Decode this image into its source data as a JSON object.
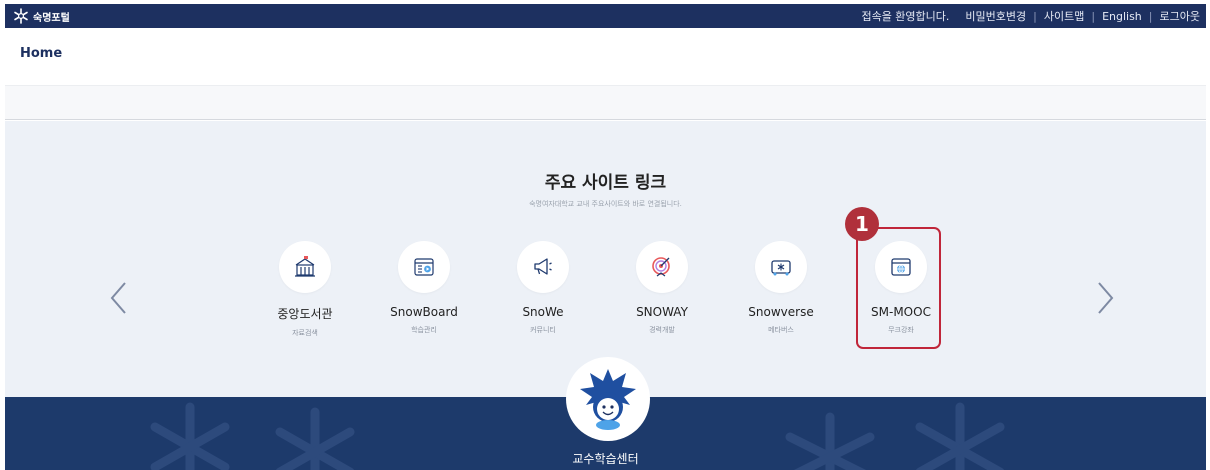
{
  "topbar": {
    "logo_text": "숙명포털",
    "welcome": "접속을 환영합니다.",
    "links": [
      "비밀번호변경",
      "사이트맵",
      "English",
      "로그아웃"
    ]
  },
  "breadcrumb": {
    "home": "Home"
  },
  "section": {
    "title": "주요 사이트 링크",
    "subtitle": "숙명여자대학교 교내 주요사이트와 바로 연결됩니다."
  },
  "items": [
    {
      "label": "중앙도서관",
      "sub": "자료검색",
      "icon": "library-icon"
    },
    {
      "label": "SnowBoard",
      "sub": "학습관리",
      "icon": "board-icon"
    },
    {
      "label": "SnoWe",
      "sub": "커뮤니티",
      "icon": "megaphone-icon"
    },
    {
      "label": "SNOWAY",
      "sub": "경력개발",
      "icon": "target-icon"
    },
    {
      "label": "Snowverse",
      "sub": "메타버스",
      "icon": "metaverse-icon"
    },
    {
      "label": "SM-MOOC",
      "sub": "무크강좌",
      "icon": "globe-window-icon"
    }
  ],
  "annotation": {
    "badge": "1"
  },
  "footer_band": {
    "center_title": "교수학습센터"
  },
  "colors": {
    "navy": "#1d3060",
    "band": "#1d3a6b",
    "accent": "#1f4fa0",
    "highlight": "#c0263a",
    "section_bg": "#edf1f7"
  }
}
